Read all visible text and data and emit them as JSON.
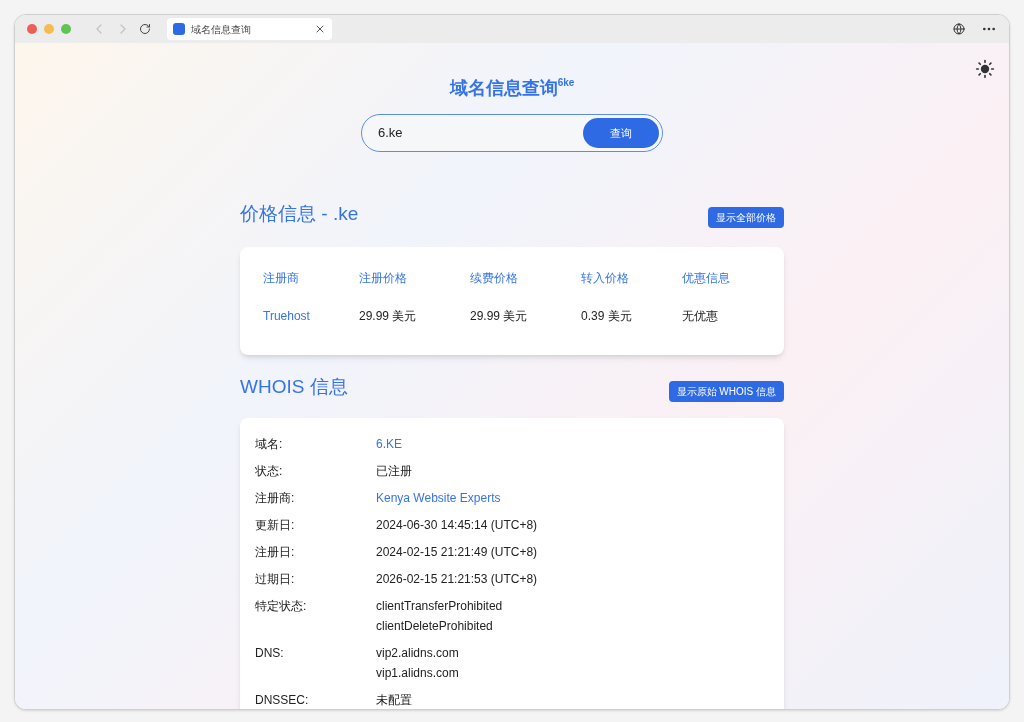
{
  "browser": {
    "tab_title": "域名信息查询"
  },
  "header": {
    "title": "域名信息查询",
    "title_mark": "6ke"
  },
  "search": {
    "value": "6.ke",
    "button": "查询"
  },
  "pricing": {
    "title": "价格信息 - .ke",
    "button": "显示全部价格",
    "columns": [
      "注册商",
      "注册价格",
      "续费价格",
      "转入价格",
      "优惠信息"
    ],
    "rows": [
      {
        "cells": [
          "Truehost",
          "29.99 美元",
          "29.99 美元",
          "0.39 美元",
          "无优惠"
        ]
      }
    ]
  },
  "whois": {
    "title": "WHOIS 信息",
    "button": "显示原始 WHOIS 信息",
    "rows": [
      {
        "label": "域名:",
        "link": true,
        "values": [
          "6.KE"
        ]
      },
      {
        "label": "状态:",
        "link": false,
        "values": [
          "已注册"
        ]
      },
      {
        "label": "注册商:",
        "link": true,
        "values": [
          "Kenya Website Experts"
        ]
      },
      {
        "label": "更新日:",
        "link": false,
        "values": [
          "2024-06-30 14:45:14 (UTC+8)"
        ]
      },
      {
        "label": "注册日:",
        "link": false,
        "values": [
          "2024-02-15 21:21:49 (UTC+8)"
        ]
      },
      {
        "label": "过期日:",
        "link": false,
        "values": [
          "2026-02-15 21:21:53 (UTC+8)"
        ]
      },
      {
        "label": "特定状态:",
        "link": false,
        "values": [
          "clientTransferProhibited",
          "clientDeleteProhibited"
        ]
      },
      {
        "label": "DNS:",
        "link": false,
        "values": [
          "vip2.alidns.com",
          "vip1.alidns.com"
        ]
      },
      {
        "label": "DNSSEC:",
        "link": false,
        "values": [
          "未配置"
        ]
      }
    ]
  }
}
